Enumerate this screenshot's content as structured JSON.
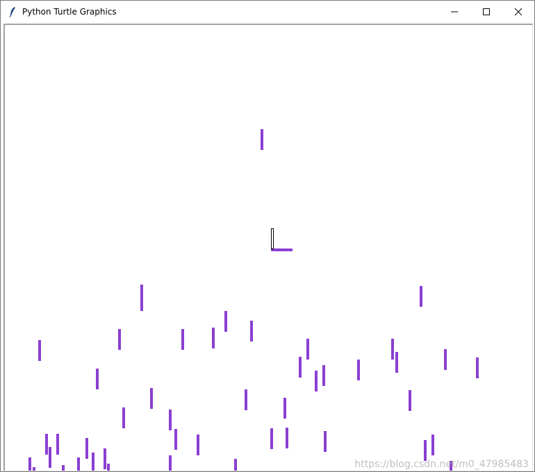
{
  "window": {
    "title": "Python Turtle Graphics"
  },
  "controls": {
    "minimize_icon": "minimize-icon",
    "maximize_icon": "maximize-icon",
    "close_icon": "close-icon"
  },
  "canvas": {
    "background": "#ffffff",
    "drop_color": "#8a3fd1",
    "paddle_color": "#8a3fd1",
    "cursor_icon": "turtle-cursor-icon"
  },
  "watermark": {
    "text": "https://blog.csdn.net/m0_47985483"
  }
}
